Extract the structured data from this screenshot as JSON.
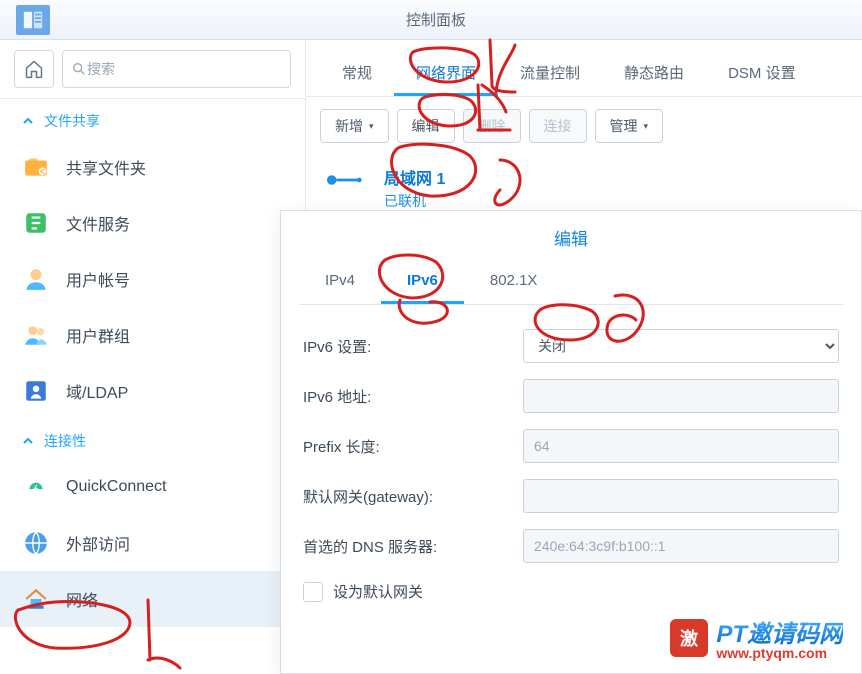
{
  "window": {
    "title": "控制面板"
  },
  "search": {
    "placeholder": "搜索"
  },
  "sidebar": {
    "sections": [
      {
        "label": "文件共享"
      },
      {
        "label": "连接性"
      }
    ],
    "items": [
      {
        "label": "共享文件夹"
      },
      {
        "label": "文件服务"
      },
      {
        "label": "用户帐号"
      },
      {
        "label": "用户群组"
      },
      {
        "label": "域/LDAP"
      },
      {
        "label": "QuickConnect"
      },
      {
        "label": "外部访问"
      },
      {
        "label": "网络"
      }
    ]
  },
  "main_tabs": [
    {
      "label": "常规"
    },
    {
      "label": "网络界面"
    },
    {
      "label": "流量控制"
    },
    {
      "label": "静态路由"
    },
    {
      "label": "DSM 设置"
    }
  ],
  "toolbar": {
    "add": "新增",
    "edit": "编辑",
    "delete": "删除",
    "connect": "连接",
    "manage": "管理"
  },
  "lan": {
    "name": "局域网 1",
    "status": "已联机"
  },
  "modal": {
    "title": "编辑",
    "tabs": [
      {
        "label": "IPv4"
      },
      {
        "label": "IPv6"
      },
      {
        "label": "802.1X"
      }
    ],
    "form": {
      "ipv6_setting_label": "IPv6 设置:",
      "ipv6_setting_value": "关闭",
      "ipv6_addr_label": "IPv6 地址:",
      "ipv6_addr_value": "",
      "prefix_label": "Prefix 长度:",
      "prefix_value": "64",
      "gateway_label": "默认网关(gateway):",
      "gateway_value": "",
      "dns_label": "首选的 DNS 服务器:",
      "dns_value": "240e:64:3c9f:b100::1",
      "default_gw_chk": "设为默认网关"
    }
  },
  "watermark": {
    "brand": "PT邀请码网",
    "url": "www.ptyqm.com"
  }
}
